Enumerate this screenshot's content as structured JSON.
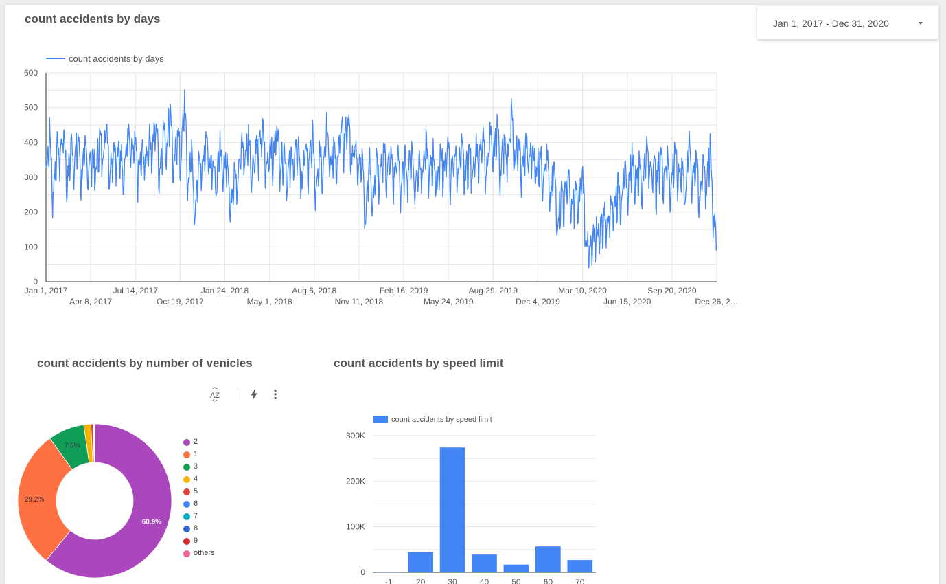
{
  "date_range": {
    "label": "Jan 1, 2017 - Dec 31, 2020"
  },
  "charts": {
    "days": {
      "title": "count accidents by days"
    },
    "vehicles": {
      "title": "count accidents by number of venicles"
    },
    "speed": {
      "title": "count accidents by speed limit"
    }
  },
  "icons": {
    "sort": "sort-az-icon",
    "bolt": "lightning-bolt-icon",
    "more": "more-vert-icon",
    "caret": "caret-down-icon"
  },
  "chart_data": [
    {
      "type": "line",
      "title": "count accidents by days",
      "legend": "count accidents by days",
      "color": "#4285f4",
      "ylim": [
        0,
        600
      ],
      "y_ticks": [
        "0",
        "100",
        "200",
        "300",
        "400",
        "500",
        "600"
      ],
      "x_tick_labels": [
        "Jan 1, 2017",
        "Apr 8, 2017",
        "Jul 14, 2017",
        "Oct 19, 2017",
        "Jan 24, 2018",
        "May 1, 2018",
        "Aug 6, 2018",
        "Nov 11, 2018",
        "Feb 16, 2019",
        "May 24, 2019",
        "Aug 29, 2019",
        "Dec 4, 2019",
        "Mar 10, 2020",
        "Jun 15, 2020",
        "Sep 20, 2020",
        "Dec 26, 2…"
      ],
      "grid": true,
      "legend_position": "top-left",
      "approx_weekly_values": [
        300,
        420,
        230,
        380,
        350,
        430,
        260,
        390,
        330,
        400,
        280,
        370,
        310,
        360,
        290,
        410,
        350,
        450,
        300,
        390,
        340,
        360,
        300,
        420,
        350,
        380,
        290,
        360,
        330,
        400,
        370,
        450,
        300,
        420,
        380,
        500,
        290,
        430,
        330,
        520,
        250,
        380,
        150,
        360,
        300,
        420,
        330,
        350,
        250,
        380,
        300,
        360,
        190,
        330,
        260,
        390,
        340,
        410,
        300,
        380,
        360,
        430,
        300,
        390,
        330,
        450,
        320,
        370,
        280,
        350,
        330,
        390,
        260,
        380,
        300,
        420,
        250,
        380,
        310,
        430,
        330,
        370,
        300,
        440,
        380,
        470,
        330,
        400,
        300,
        380,
        150,
        360,
        200,
        340,
        260,
        380,
        300,
        350,
        280,
        360,
        250,
        340,
        300,
        370,
        250,
        350,
        300,
        380,
        290,
        360,
        260,
        360,
        300,
        390,
        280,
        360,
        310,
        370,
        290,
        360,
        300,
        380,
        330,
        400,
        300,
        420,
        330,
        450,
        300,
        400,
        340,
        480,
        320,
        400,
        290,
        390,
        330,
        380,
        300,
        360,
        290,
        370,
        200,
        330,
        150,
        250,
        220,
        300,
        180,
        250,
        200,
        320,
        120,
        60,
        100,
        140,
        130,
        180,
        160,
        220,
        200,
        260,
        230,
        300,
        250,
        350,
        280,
        320,
        260,
        380,
        300,
        340,
        260,
        360,
        290,
        350,
        240,
        380,
        270,
        340,
        230,
        390,
        280,
        360,
        200,
        350,
        250,
        380,
        160
      ]
    },
    {
      "type": "pie",
      "donut": true,
      "title": "count accidents by number of venicles",
      "slices": [
        {
          "label": "2",
          "value": 60.9,
          "color": "#ab47bc",
          "shown_label": "60.9%"
        },
        {
          "label": "1",
          "value": 29.2,
          "color": "#ff7043",
          "shown_label": "29.2%"
        },
        {
          "label": "3",
          "value": 7.6,
          "color": "#0f9d58",
          "shown_label": "7.6%"
        },
        {
          "label": "4",
          "value": 1.5,
          "color": "#f4b400",
          "shown_label": ""
        },
        {
          "label": "5",
          "value": 0.5,
          "color": "#db4437",
          "shown_label": ""
        },
        {
          "label": "6",
          "value": 0.1,
          "color": "#4285f4",
          "shown_label": ""
        },
        {
          "label": "7",
          "value": 0.05,
          "color": "#00acc1",
          "shown_label": ""
        },
        {
          "label": "8",
          "value": 0.05,
          "color": "#3367d6",
          "shown_label": ""
        },
        {
          "label": "9",
          "value": 0.03,
          "color": "#d32f2f",
          "shown_label": ""
        },
        {
          "label": "others",
          "value": 0.07,
          "color": "#f06292",
          "shown_label": ""
        }
      ],
      "legend_position": "right"
    },
    {
      "type": "bar",
      "title": "count accidents by speed limit",
      "legend": "count accidents by speed limit",
      "color": "#4285f4",
      "categories": [
        "-1",
        "20",
        "30",
        "40",
        "50",
        "60",
        "70"
      ],
      "values": [
        300,
        44000,
        274000,
        39000,
        17000,
        57000,
        27000
      ],
      "ylim": [
        0,
        300000
      ],
      "y_ticks": [
        "0",
        "100K",
        "200K",
        "300K"
      ],
      "grid": true,
      "legend_position": "top-left"
    }
  ]
}
